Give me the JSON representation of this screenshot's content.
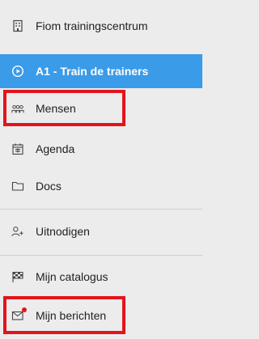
{
  "org": {
    "label": "Fiom trainingscentrum",
    "icon": "building-icon"
  },
  "active_course": {
    "label": "A1 - Train de trainers",
    "icon": "play-circle-icon"
  },
  "nav": {
    "people": {
      "label": "Mensen",
      "icon": "people-icon"
    },
    "agenda": {
      "label": "Agenda",
      "icon": "calendar-icon"
    },
    "docs": {
      "label": "Docs",
      "icon": "folder-icon"
    },
    "invite": {
      "label": "Uitnodigen",
      "icon": "user-plus-icon"
    },
    "catalog": {
      "label": "Mijn catalogus",
      "icon": "flag-checkered-icon"
    },
    "messages": {
      "label": "Mijn berichten",
      "icon": "envelope-icon"
    }
  },
  "colors": {
    "active_bg": "#3a9be8",
    "highlight": "#e4141b",
    "background": "#ececec"
  }
}
